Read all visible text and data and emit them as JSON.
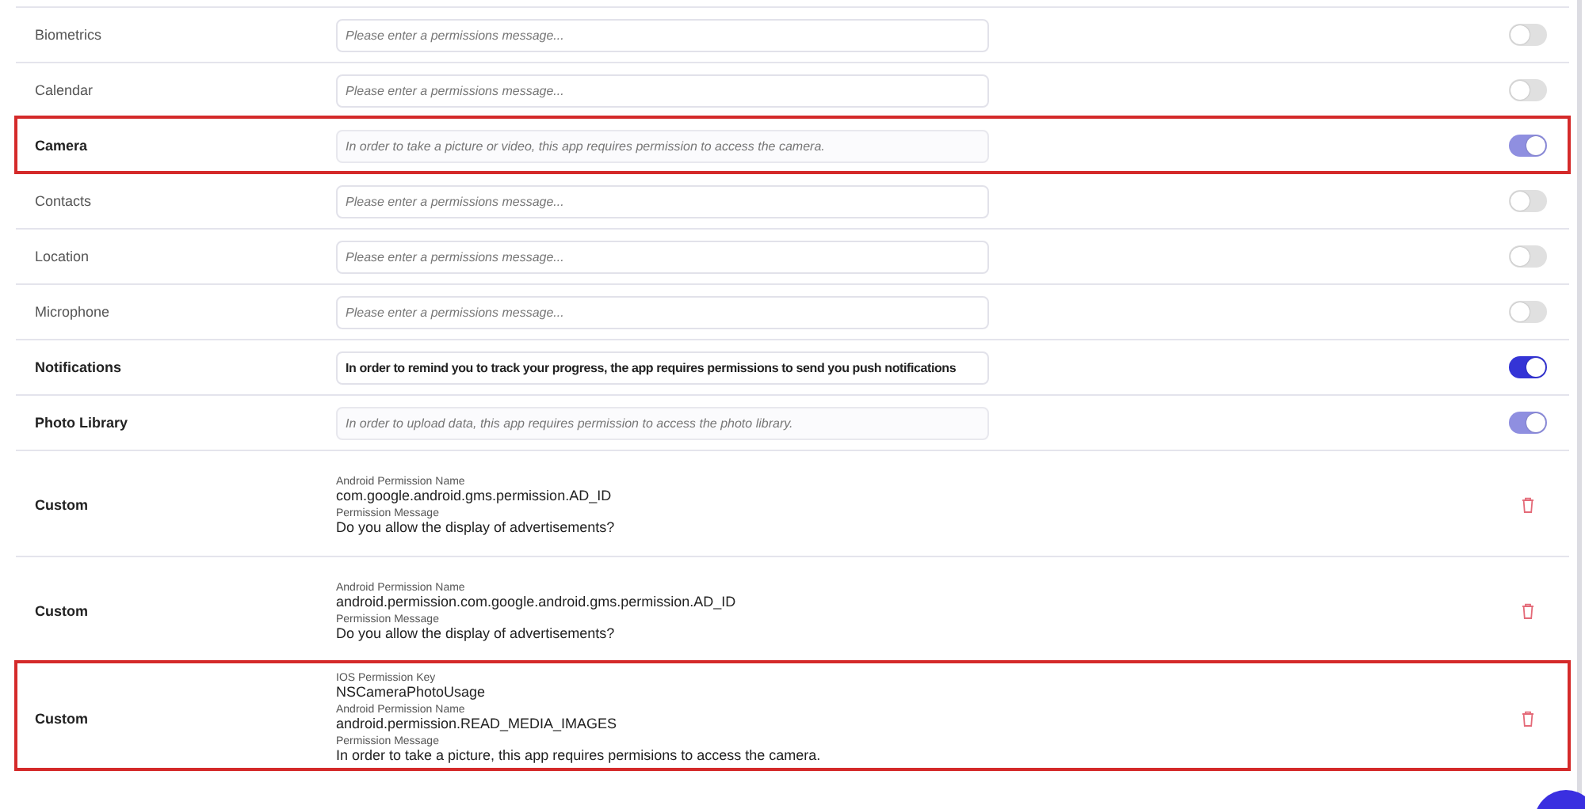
{
  "permissions": [
    {
      "kind": "toggle",
      "label": "Biometrics",
      "placeholder": "Please enter a permissions message...",
      "on": false,
      "disabled": false,
      "highlighted": false
    },
    {
      "kind": "toggle",
      "label": "Calendar",
      "placeholder": "Please enter a permissions message...",
      "on": false,
      "disabled": false,
      "highlighted": false
    },
    {
      "kind": "toggle",
      "label": "Camera",
      "placeholder": "In order to take a picture or video, this app requires permission to access the camera.",
      "on": true,
      "disabled": true,
      "highlighted": true
    },
    {
      "kind": "toggle",
      "label": "Contacts",
      "placeholder": "Please enter a permissions message...",
      "on": false,
      "disabled": false,
      "highlighted": false
    },
    {
      "kind": "toggle",
      "label": "Location",
      "placeholder": "Please enter a permissions message...",
      "on": false,
      "disabled": false,
      "highlighted": false
    },
    {
      "kind": "toggle",
      "label": "Microphone",
      "placeholder": "Please enter a permissions message...",
      "on": false,
      "disabled": false,
      "highlighted": false
    },
    {
      "kind": "toggle",
      "label": "Notifications",
      "value": "In order to remind you to track your progress, the app requires permissions to send you push notifications",
      "on": true,
      "disabled": false,
      "highlighted": false
    },
    {
      "kind": "toggle",
      "label": "Photo Library",
      "placeholder": "In order to upload data, this app requires permission to access the photo library.",
      "on": true,
      "disabled": true,
      "highlighted": false
    },
    {
      "kind": "custom",
      "label": "Custom",
      "highlighted": false,
      "fields": [
        {
          "caption": "Android Permission Name",
          "value": "com.google.android.gms.permission.AD_ID"
        },
        {
          "caption": "Permission Message",
          "value": "Do you allow the display of advertisements?"
        }
      ]
    },
    {
      "kind": "custom",
      "label": "Custom",
      "highlighted": false,
      "fields": [
        {
          "caption": "Android Permission Name",
          "value": "android.permission.com.google.android.gms.permission.AD_ID"
        },
        {
          "caption": "Permission Message",
          "value": "Do you allow the display of advertisements?"
        }
      ]
    },
    {
      "kind": "custom",
      "label": "Custom",
      "highlighted": true,
      "fields": [
        {
          "caption": "IOS Permission Key",
          "value": "NSCameraPhotoUsage"
        },
        {
          "caption": "Android Permission Name",
          "value": "android.permission.READ_MEDIA_IMAGES"
        },
        {
          "caption": "Permission Message",
          "value": "In order to take a picture, this app requires permisions to access the camera."
        }
      ]
    }
  ]
}
